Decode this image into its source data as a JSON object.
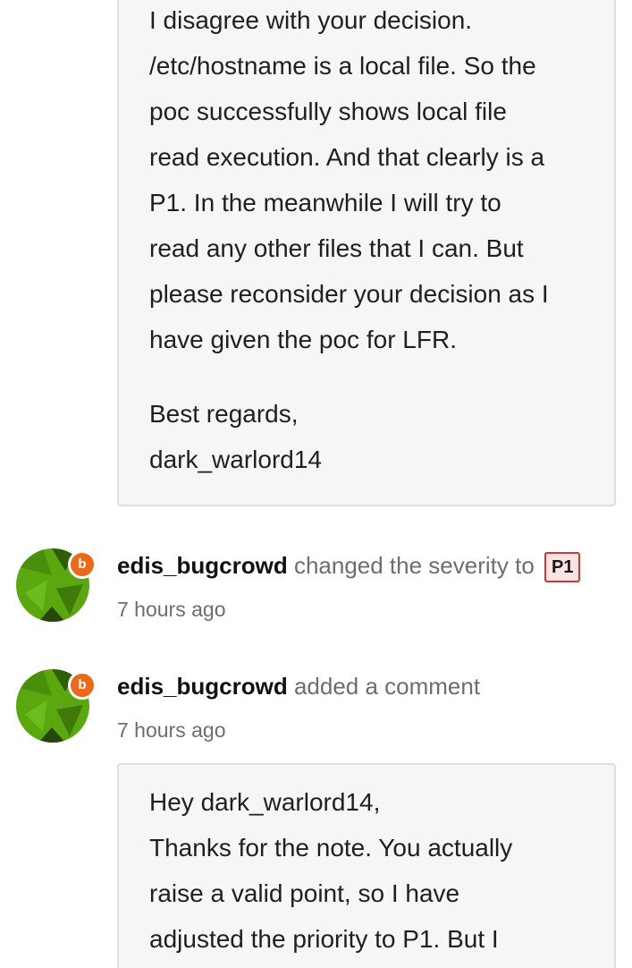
{
  "comment_1": {
    "lines": [
      "I disagree with your decision.",
      "/etc/hostname is a local file. So the",
      "poc successfully shows local file",
      "read execution. And that clearly is a",
      "P1. In the meanwhile I will try to",
      "read any other files that I can. But",
      "please reconsider your decision as I",
      "have given the poc for LFR."
    ],
    "signoff": [
      "Best regards,",
      "dark_warlord14"
    ]
  },
  "event_1": {
    "avatar_badge": "b",
    "username": "edis_bugcrowd",
    "action": "changed the severity to",
    "severity": "P1",
    "timestamp": "7 hours ago"
  },
  "event_2": {
    "avatar_badge": "b",
    "username": "edis_bugcrowd",
    "action": "added a comment",
    "timestamp": "7 hours ago"
  },
  "comment_2": {
    "lines": [
      "Hey dark_warlord14,",
      "Thanks for the note. You actually",
      "raise a valid point, so I have",
      "adjusted the priority to P1. But I"
    ]
  },
  "colors": {
    "avatar_green": "#5aa70f",
    "badge_orange": "#ea6a1b",
    "severity_border": "#c83a3a",
    "severity_bg": "#fbe3e3"
  }
}
